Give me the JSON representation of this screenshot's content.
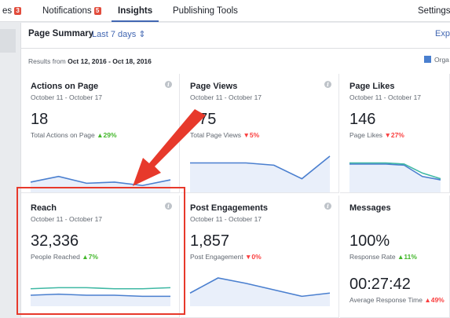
{
  "topbar": {
    "tabs": [
      {
        "label": "es",
        "badge": "3"
      },
      {
        "label": "Notifications",
        "badge": "5"
      },
      {
        "label": "Insights",
        "badge": ""
      },
      {
        "label": "Publishing Tools",
        "badge": ""
      },
      {
        "label": "Settings",
        "badge": ""
      }
    ]
  },
  "summary": {
    "title": "Page Summary",
    "range_label": "Last 7 days ⇕",
    "export_label": "Exp",
    "results_prefix": "Results from",
    "results_range": "Oct 12, 2016 - Oct 18, 2016",
    "legend_label": "Orga",
    "legend_color": "#4a7fcf"
  },
  "cards": {
    "actions": {
      "title": "Actions on Page",
      "dates": "October 11 - October 17",
      "value": "18",
      "sub": "Total Actions on Page",
      "change": "▲29%",
      "trend": "up",
      "series": [
        7,
        12,
        6,
        7,
        4,
        9
      ]
    },
    "views": {
      "title": "Page Views",
      "dates": "October 11 - October 17",
      "value": "475",
      "sub": "Total Page Views",
      "change": "▼5%",
      "trend": "down",
      "series": [
        24,
        24,
        24,
        22,
        10,
        30
      ]
    },
    "likes": {
      "title": "Page Likes",
      "dates": "October 11 - October 17",
      "value": "146",
      "sub": "Page Likes",
      "change": "▼27%",
      "trend": "down",
      "series": [
        24,
        24,
        24,
        23,
        15,
        10
      ],
      "series2": [
        23,
        23,
        23,
        22,
        12,
        9
      ]
    },
    "reach": {
      "title": "Reach",
      "dates": "October 11 - October 17",
      "value": "32,336",
      "sub": "People Reached",
      "change": "▲7%",
      "trend": "up",
      "series": [
        14,
        15,
        15,
        14,
        14,
        15
      ],
      "series2": [
        8,
        9,
        8,
        8,
        7,
        7
      ]
    },
    "engagements": {
      "title": "Post Engagements",
      "dates": "October 11 - October 17",
      "value": "1,857",
      "sub": "Post Engagement",
      "change": "▼0%",
      "trend": "down",
      "series": [
        10,
        24,
        19,
        13,
        7,
        10
      ]
    },
    "messages": {
      "title": "Messages",
      "value": "100%",
      "sub": "Response Rate",
      "change": "▲11%",
      "trend": "up",
      "value2": "00:27:42",
      "sub2": "Average Response Time",
      "change2": "▲49%",
      "trend2": "down"
    }
  }
}
